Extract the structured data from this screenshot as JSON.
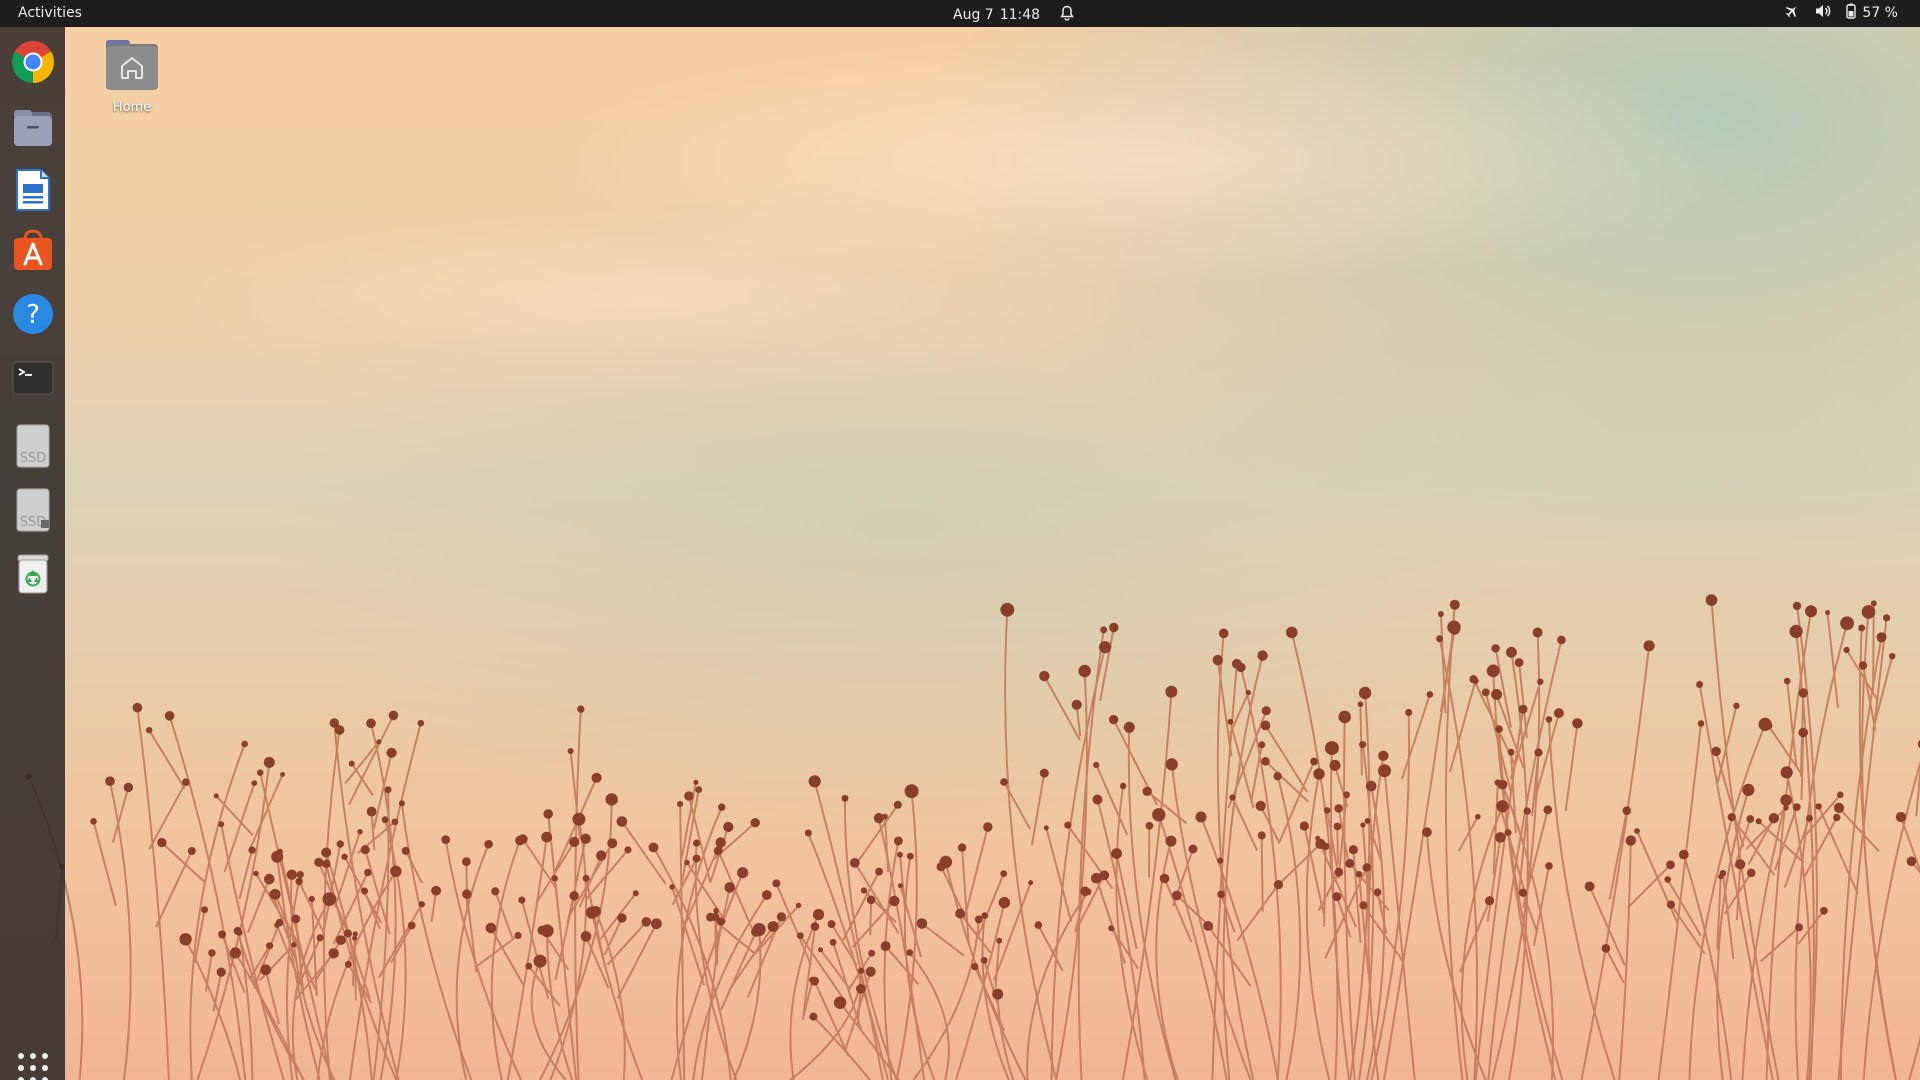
{
  "topbar": {
    "activities_label": "Activities",
    "date": "Aug 7",
    "time": "11:48",
    "battery_percent": "57 %",
    "icons": [
      "alarm-bell-icon",
      "airplane-mode-icon",
      "volume-icon",
      "battery-icon"
    ]
  },
  "dock": {
    "items": [
      {
        "name": "chrome",
        "icon": "chrome-icon"
      },
      {
        "name": "files",
        "icon": "files-icon"
      },
      {
        "name": "writer",
        "icon": "libreoffice-writer-icon"
      },
      {
        "name": "software",
        "icon": "app-store-icon"
      },
      {
        "name": "help",
        "icon": "help-icon"
      },
      {
        "name": "terminal",
        "icon": "terminal-icon"
      },
      {
        "name": "ssd-1",
        "icon": "ssd-drive-icon",
        "text": "SSD"
      },
      {
        "name": "ssd-2",
        "icon": "ssd-drive-icon",
        "text": "SSD"
      },
      {
        "name": "trash",
        "icon": "trash-icon"
      }
    ],
    "show_apps_icon": "apps-grid-icon"
  },
  "desktop": {
    "home_icon_label": "Home",
    "home_icon": "home-folder-icon"
  },
  "colors": {
    "topbar_bg": "#1d1d1d",
    "dock_bg": "#2c2826",
    "chrome_red": "#db4437",
    "chrome_yellow": "#f4b400",
    "chrome_green": "#0f9d58",
    "chrome_blue": "#4285f4",
    "software_orange": "#e95420",
    "help_blue": "#2a8ae2"
  }
}
